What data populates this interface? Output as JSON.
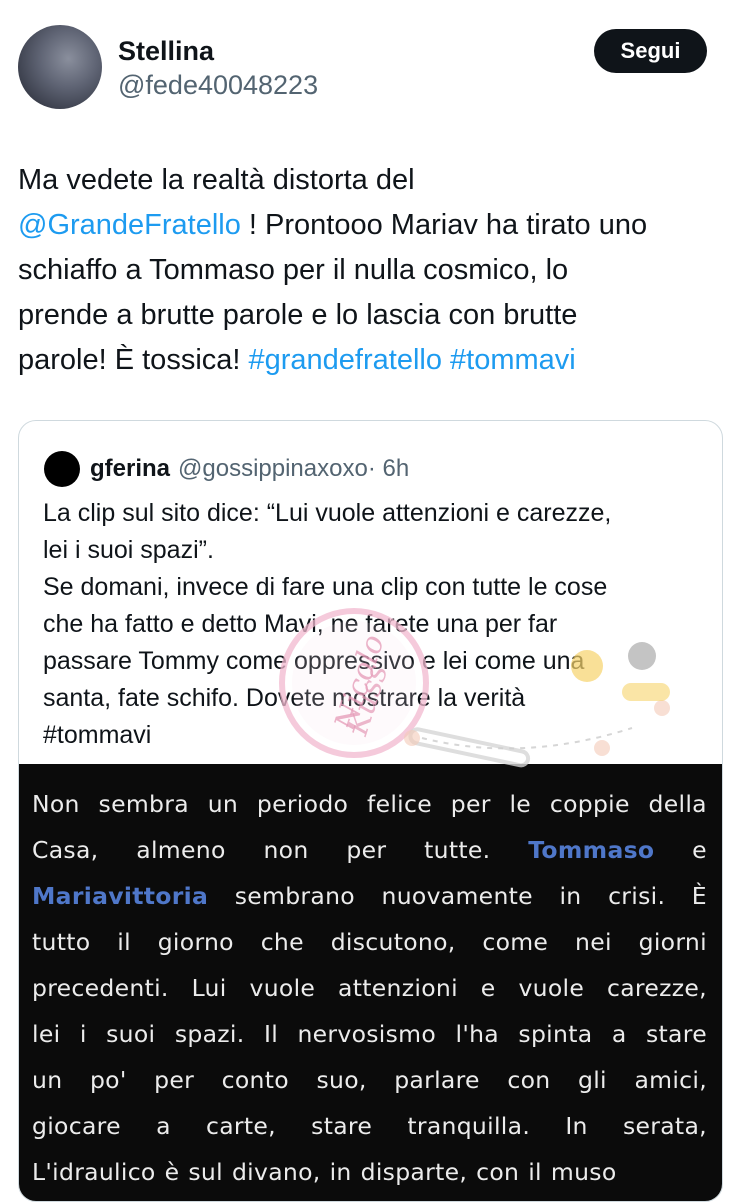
{
  "user": {
    "name": "Stellina",
    "handle": "@fede40048223",
    "follow_label": "Segui"
  },
  "tweet": {
    "lines": [
      [
        {
          "t": "Ma vedete la realtà distorta del"
        }
      ],
      [
        {
          "t": "@GrandeFratello",
          "link": true
        },
        {
          "t": " ! Prontooo Mariav ha tirato uno"
        }
      ],
      [
        {
          "t": "schiaffo a Tommaso per il nulla cosmico, lo"
        }
      ],
      [
        {
          "t": "prende a brutte parole e lo lascia con brutte"
        }
      ],
      [
        {
          "t": "parole! È tossica! "
        },
        {
          "t": "#grandefratello",
          "link": true
        },
        {
          "t": " "
        },
        {
          "t": "#tommavi",
          "link": true
        }
      ]
    ]
  },
  "quote": {
    "name": "gferina",
    "handle": "@gossippinaxoxo",
    "time": "· 6h",
    "lines": [
      "La clip sul sito dice: “Lui vuole attenzioni e carezze,",
      "lei i suoi spazi”.",
      "Se domani, invece di fare una clip con tutte le cose",
      "che ha fatto e detto Mavi, ne farete una per far",
      "passare Tommy come oppressivo e lei come una",
      "santa, fate schifo. Dovete mostrare la verità",
      "#tommavi"
    ],
    "watermark_text": "Nicolo Kuss"
  },
  "article": {
    "lines": [
      {
        "words": [
          {
            "t": "Non"
          },
          {
            "t": "sembra"
          },
          {
            "t": "un"
          },
          {
            "t": "periodo"
          },
          {
            "t": "felice"
          },
          {
            "t": "per"
          },
          {
            "t": "le"
          },
          {
            "t": "coppie"
          },
          {
            "t": "della"
          }
        ]
      },
      {
        "words": [
          {
            "t": "Casa,"
          },
          {
            "t": "almeno"
          },
          {
            "t": "non"
          },
          {
            "t": "per"
          },
          {
            "t": "tutte."
          },
          {
            "t": "Tommaso",
            "hl": true
          },
          {
            "t": "e"
          }
        ]
      },
      {
        "words": [
          {
            "t": "Mariavittoria",
            "hl": true
          },
          {
            "t": "sembrano"
          },
          {
            "t": "nuovamente"
          },
          {
            "t": "in"
          },
          {
            "t": "crisi."
          },
          {
            "t": "È"
          }
        ]
      },
      {
        "words": [
          {
            "t": "tutto"
          },
          {
            "t": "il"
          },
          {
            "t": "giorno"
          },
          {
            "t": "che"
          },
          {
            "t": "discutono,"
          },
          {
            "t": "come"
          },
          {
            "t": "nei"
          },
          {
            "t": "giorni"
          }
        ]
      },
      {
        "words": [
          {
            "t": "precedenti."
          },
          {
            "t": "Lui"
          },
          {
            "t": "vuole"
          },
          {
            "t": "attenzioni"
          },
          {
            "t": "e"
          },
          {
            "t": "vuole"
          },
          {
            "t": "carezze,"
          }
        ]
      },
      {
        "words": [
          {
            "t": "lei"
          },
          {
            "t": "i"
          },
          {
            "t": "suoi"
          },
          {
            "t": "spazi."
          },
          {
            "t": "Il"
          },
          {
            "t": "nervosismo"
          },
          {
            "t": "l'ha"
          },
          {
            "t": "spinta"
          },
          {
            "t": "a"
          },
          {
            "t": "stare"
          }
        ]
      },
      {
        "words": [
          {
            "t": "un"
          },
          {
            "t": "po'"
          },
          {
            "t": "per"
          },
          {
            "t": "conto"
          },
          {
            "t": "suo,"
          },
          {
            "t": "parlare"
          },
          {
            "t": "con"
          },
          {
            "t": "gli"
          },
          {
            "t": "amici,"
          }
        ]
      },
      {
        "words": [
          {
            "t": "giocare"
          },
          {
            "t": "a"
          },
          {
            "t": "carte,"
          },
          {
            "t": "stare"
          },
          {
            "t": "tranquilla."
          },
          {
            "t": "In"
          },
          {
            "t": "serata,"
          }
        ]
      },
      {
        "words": [
          {
            "t": "L'idraulico"
          },
          {
            "t": "è"
          },
          {
            "t": "sul"
          },
          {
            "t": "divano,"
          },
          {
            "t": "in"
          },
          {
            "t": "disparte,"
          },
          {
            "t": "con"
          },
          {
            "t": "il"
          },
          {
            "t": "muso"
          }
        ],
        "last": true
      }
    ]
  },
  "colors": {
    "link": "#1d9bf0",
    "highlight": "#4f77c9",
    "follow_bg": "#0f1419",
    "article_bg": "#0b0b0b"
  }
}
